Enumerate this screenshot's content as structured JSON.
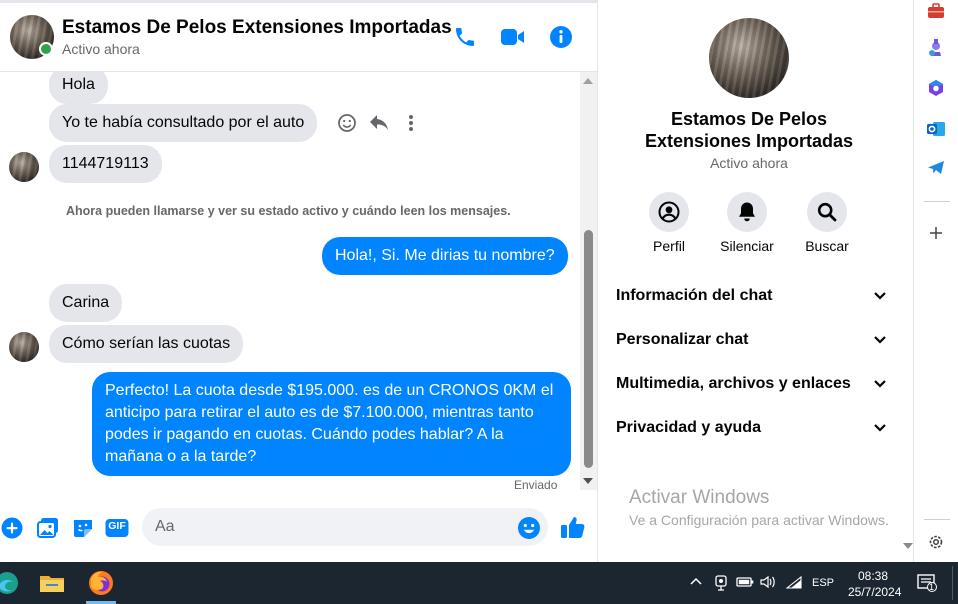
{
  "header": {
    "contact_name": "Estamos De Pelos Extensiones Importadas",
    "status": "Activo ahora",
    "status_color": "#31a24c"
  },
  "messages": {
    "items": [
      {
        "from": "them",
        "text": "Hola"
      },
      {
        "from": "them",
        "text": "Yo te había consultado por el auto"
      },
      {
        "from": "them",
        "text": "1144719113"
      },
      {
        "from": "me",
        "text": "Hola!, Si. Me dirias tu nombre?"
      },
      {
        "from": "them",
        "text": "Carina"
      },
      {
        "from": "them",
        "text": "Cómo serían las cuotas"
      },
      {
        "from": "me",
        "lines": [
          "Perfecto! La cuota desde $195.000. es de un CRONOS 0KM el",
          "anticipo para retirar el auto es de $7.100.000, mientras tanto",
          "podes ir pagando en cuotas. Cuándo podes hablar? A la",
          "mañana o a la tarde?"
        ]
      }
    ],
    "system_notice": "Ahora pueden llamarse y ver su estado activo y cuándo leen los mensajes.",
    "delivery_status": "Enviado",
    "outgoing_color": "#0084ff",
    "incoming_color": "#e4e6eb"
  },
  "composer": {
    "placeholder": "Aa",
    "icons": [
      "plus-icon",
      "gallery-icon",
      "sticker-icon",
      "gif-icon",
      "emoji-icon",
      "like-icon"
    ],
    "gif_label": "GIF"
  },
  "side_panel": {
    "name_line1": "Estamos De Pelos",
    "name_line2": "Extensiones Importadas",
    "status": "Activo ahora",
    "actions": [
      {
        "label": "Perfil",
        "icon": "profile-icon"
      },
      {
        "label": "Silenciar",
        "icon": "bell-icon"
      },
      {
        "label": "Buscar",
        "icon": "search-icon"
      }
    ],
    "sections": [
      {
        "label": "Información del chat"
      },
      {
        "label": "Personalizar chat"
      },
      {
        "label": "Multimedia, archivos y enlaces"
      },
      {
        "label": "Privacidad y ayuda"
      }
    ],
    "watermark_title": "Activar Windows",
    "watermark_subtitle": "Ve a Configuración para activar Windows."
  },
  "edge_sidebar": {
    "icons": [
      "toolbox-icon",
      "games-icon",
      "copilot-icon",
      "outlook-icon",
      "telegram-icon",
      "add-icon",
      "settings-icon"
    ]
  },
  "taskbar": {
    "apps": [
      "edge-icon",
      "file-explorer-icon",
      "firefox-icon"
    ],
    "language": "ESP",
    "time": "08:38",
    "date": "25/7/2024",
    "notification_count": "1"
  }
}
